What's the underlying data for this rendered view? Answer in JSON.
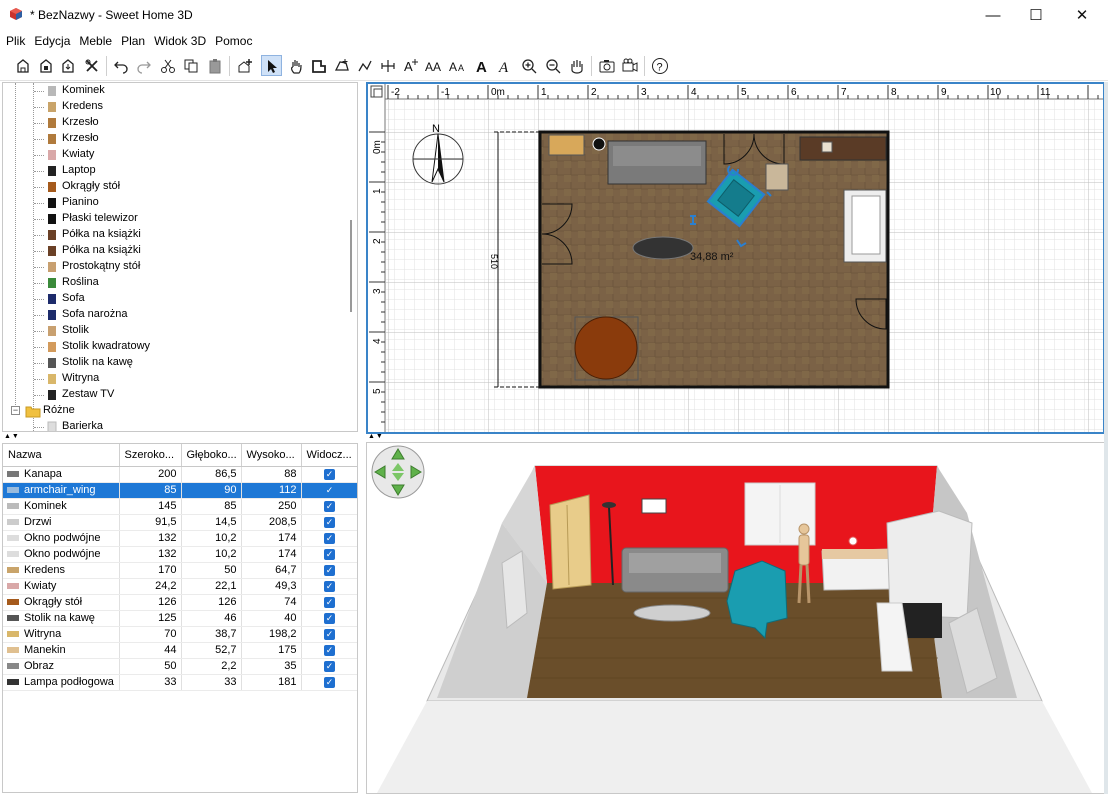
{
  "window": {
    "title": "* BezNazwy - Sweet Home 3D",
    "controls": [
      "—",
      "☐",
      "✕"
    ]
  },
  "menu": [
    "Plik",
    "Edycja",
    "Meble",
    "Plan",
    "Widok 3D",
    "Pomoc"
  ],
  "toolbar_icons": [
    "new-home-icon",
    "open-icon",
    "save-icon",
    "preferences-icon",
    "undo-icon",
    "redo-icon",
    "cut-icon",
    "copy-icon",
    "paste-icon",
    "add-furniture-icon",
    "select-mode-icon",
    "pan-mode-icon",
    "create-walls-icon",
    "create-rooms-icon",
    "create-polylines-icon",
    "create-dimensions-icon",
    "add-text-icon",
    "increase-text-size-icon",
    "decrease-text-size-icon",
    "bold-text-icon",
    "italic-text-icon",
    "zoom-in-icon",
    "zoom-out-icon",
    "aerial-view-icon",
    "create-photo-icon",
    "create-video-icon",
    "help-icon"
  ],
  "catalog": {
    "items": [
      {
        "label": "Kominek",
        "icon": "fireplace-icon"
      },
      {
        "label": "Kredens",
        "icon": "sideboard-icon"
      },
      {
        "label": "Krzesło",
        "icon": "chair-icon"
      },
      {
        "label": "Krzesło",
        "icon": "chair-icon"
      },
      {
        "label": "Kwiaty",
        "icon": "flowers-icon"
      },
      {
        "label": "Laptop",
        "icon": "laptop-icon"
      },
      {
        "label": "Okrągły stół",
        "icon": "round-table-icon"
      },
      {
        "label": "Pianino",
        "icon": "piano-icon"
      },
      {
        "label": "Płaski telewizor",
        "icon": "tv-icon"
      },
      {
        "label": "Półka na książki",
        "icon": "bookshelf-icon"
      },
      {
        "label": "Półka na książki",
        "icon": "bookshelf-icon"
      },
      {
        "label": "Prostokątny stół",
        "icon": "rectangular-table-icon"
      },
      {
        "label": "Roślina",
        "icon": "plant-icon"
      },
      {
        "label": "Sofa",
        "icon": "sofa-icon"
      },
      {
        "label": "Sofa narożna",
        "icon": "corner-sofa-icon"
      },
      {
        "label": "Stolik",
        "icon": "small-table-icon"
      },
      {
        "label": "Stolik kwadratowy",
        "icon": "square-table-icon"
      },
      {
        "label": "Stolik na kawę",
        "icon": "coffee-table-icon"
      },
      {
        "label": "Witryna",
        "icon": "cabinet-icon"
      },
      {
        "label": "Zestaw TV",
        "icon": "tv-set-icon"
      }
    ],
    "category": {
      "label": "Różne",
      "icon": "folder-icon",
      "expand": "−"
    },
    "sub_items": [
      {
        "label": "Barierka",
        "icon": "barrier-icon"
      }
    ]
  },
  "splitter_arrows": "▲▼",
  "furniture_table": {
    "columns": [
      "Nazwa",
      "Szeroko...",
      "Głęboko...",
      "Wysoko...",
      "Widocz..."
    ],
    "rows": [
      {
        "name": "Kanapa",
        "w": "200",
        "d": "86,5",
        "h": "88",
        "visible": true,
        "selected": false,
        "icon": "sofa-icon"
      },
      {
        "name": "armchair_wing",
        "w": "85",
        "d": "90",
        "h": "112",
        "visible": true,
        "selected": true,
        "icon": "armchair-icon"
      },
      {
        "name": "Kominek",
        "w": "145",
        "d": "85",
        "h": "250",
        "visible": true,
        "selected": false,
        "icon": "fireplace-icon"
      },
      {
        "name": "Drzwi",
        "w": "91,5",
        "d": "14,5",
        "h": "208,5",
        "visible": true,
        "selected": false,
        "icon": "door-icon"
      },
      {
        "name": "Okno podwójne",
        "w": "132",
        "d": "10,2",
        "h": "174",
        "visible": true,
        "selected": false,
        "icon": "window-icon"
      },
      {
        "name": "Okno podwójne",
        "w": "132",
        "d": "10,2",
        "h": "174",
        "visible": true,
        "selected": false,
        "icon": "window-icon"
      },
      {
        "name": "Kredens",
        "w": "170",
        "d": "50",
        "h": "64,7",
        "visible": true,
        "selected": false,
        "icon": "sideboard-icon"
      },
      {
        "name": "Kwiaty",
        "w": "24,2",
        "d": "22,1",
        "h": "49,3",
        "visible": true,
        "selected": false,
        "icon": "flowers-icon"
      },
      {
        "name": "Okrągły stół",
        "w": "126",
        "d": "126",
        "h": "74",
        "visible": true,
        "selected": false,
        "icon": "round-table-icon"
      },
      {
        "name": "Stolik na kawę",
        "w": "125",
        "d": "46",
        "h": "40",
        "visible": true,
        "selected": false,
        "icon": "coffee-table-icon"
      },
      {
        "name": "Witryna",
        "w": "70",
        "d": "38,7",
        "h": "198,2",
        "visible": true,
        "selected": false,
        "icon": "cabinet-icon"
      },
      {
        "name": "Manekin",
        "w": "44",
        "d": "52,7",
        "h": "175",
        "visible": true,
        "selected": false,
        "icon": "mannequin-icon"
      },
      {
        "name": "Obraz",
        "w": "50",
        "d": "2,2",
        "h": "35",
        "visible": true,
        "selected": false,
        "icon": "picture-icon"
      },
      {
        "name": "Lampa podłogowa",
        "w": "33",
        "d": "33",
        "h": "181",
        "visible": true,
        "selected": false,
        "icon": "floor-lamp-icon"
      }
    ],
    "check_glyph": "✓"
  },
  "plan": {
    "ruler_x": [
      "-2",
      "-1",
      "0m",
      "1",
      "2",
      "3",
      "4",
      "5",
      "6",
      "7",
      "8",
      "9",
      "10",
      "11"
    ],
    "ruler_y": [
      "0m",
      "1",
      "2",
      "3",
      "4",
      "5"
    ],
    "room_area": "34,88 m²",
    "dimension_label": "510",
    "compass_label": "N",
    "colors": {
      "floor": "#7a6347",
      "wall": "#1a1a1a",
      "grid": "#d6d6d6",
      "selection": "#2a7fd0"
    }
  },
  "view3d": {
    "colors": {
      "back_wall": "#e8151c",
      "floor": "#6a4e2a",
      "side_wall": "#c9c9c9",
      "armchair": "#1a9db0"
    }
  }
}
